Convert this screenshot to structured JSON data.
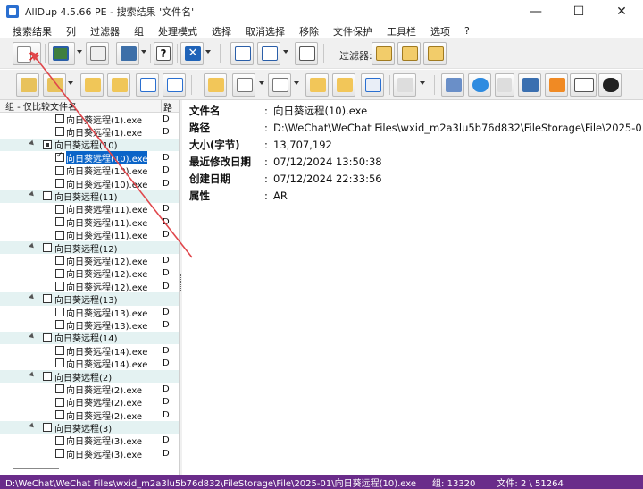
{
  "window": {
    "title": "AllDup 4.5.66 PE - 搜索结果 '文件名'",
    "controls": [
      "—",
      "☐",
      "✕"
    ]
  },
  "menu": [
    "搜索结果",
    "列",
    "过滤器",
    "组",
    "处理模式",
    "选择",
    "取消选择",
    "移除",
    "文件保护",
    "工具栏",
    "选项",
    "?"
  ],
  "toolbar": {
    "filter_label": "过滤器:",
    "icons": [
      "delete-results-icon",
      "preview-icon",
      "log-icon",
      "save-icon",
      "help-icon",
      "close-icon",
      "columns-icon",
      "columns-dropdown-icon",
      "size-units-icon",
      "filter1-icon",
      "filter2-icon",
      "filter3-icon",
      "nav-prev-icon",
      "nav-next-icon",
      "group-up-icon",
      "group-down-icon",
      "move-up-icon",
      "move-down-icon",
      "folder-icon",
      "select-icon",
      "deselect-icon",
      "folder-add-icon",
      "folder-open-icon",
      "compare-icon",
      "undo-icon",
      "image-viewer-icon",
      "ie-icon",
      "media-icon",
      "picture-icon",
      "vlc-icon",
      "exe-icon",
      "sound-icon"
    ]
  },
  "tree": {
    "header": "组 - 仅比较文件名",
    "header_col2": "路",
    "rows": [
      {
        "type": "file",
        "name": "向日葵远程(1).exe",
        "col": "D",
        "checked": false
      },
      {
        "type": "file",
        "name": "向日葵远程(1).exe",
        "col": "D",
        "checked": false
      },
      {
        "type": "group",
        "name": "向日葵远程(10)",
        "state": "partial"
      },
      {
        "type": "file",
        "name": "向日葵远程(10).exe",
        "col": "D",
        "checked": true,
        "selected": true
      },
      {
        "type": "file",
        "name": "向日葵远程(10).exe",
        "col": "D",
        "checked": false
      },
      {
        "type": "file",
        "name": "向日葵远程(10).exe",
        "col": "D",
        "checked": false
      },
      {
        "type": "group",
        "name": "向日葵远程(11)",
        "state": "none"
      },
      {
        "type": "file",
        "name": "向日葵远程(11).exe",
        "col": "D",
        "checked": false
      },
      {
        "type": "file",
        "name": "向日葵远程(11).exe",
        "col": "D",
        "checked": false
      },
      {
        "type": "file",
        "name": "向日葵远程(11).exe",
        "col": "D",
        "checked": false
      },
      {
        "type": "group",
        "name": "向日葵远程(12)",
        "state": "none"
      },
      {
        "type": "file",
        "name": "向日葵远程(12).exe",
        "col": "D",
        "checked": false
      },
      {
        "type": "file",
        "name": "向日葵远程(12).exe",
        "col": "D",
        "checked": false
      },
      {
        "type": "file",
        "name": "向日葵远程(12).exe",
        "col": "D",
        "checked": false
      },
      {
        "type": "group",
        "name": "向日葵远程(13)",
        "state": "none"
      },
      {
        "type": "file",
        "name": "向日葵远程(13).exe",
        "col": "D",
        "checked": false
      },
      {
        "type": "file",
        "name": "向日葵远程(13).exe",
        "col": "D",
        "checked": false
      },
      {
        "type": "group",
        "name": "向日葵远程(14)",
        "state": "none"
      },
      {
        "type": "file",
        "name": "向日葵远程(14).exe",
        "col": "D",
        "checked": false
      },
      {
        "type": "file",
        "name": "向日葵远程(14).exe",
        "col": "D",
        "checked": false
      },
      {
        "type": "group",
        "name": "向日葵远程(2)",
        "state": "none"
      },
      {
        "type": "file",
        "name": "向日葵远程(2).exe",
        "col": "D",
        "checked": false
      },
      {
        "type": "file",
        "name": "向日葵远程(2).exe",
        "col": "D",
        "checked": false
      },
      {
        "type": "file",
        "name": "向日葵远程(2).exe",
        "col": "D",
        "checked": false
      },
      {
        "type": "group",
        "name": "向日葵远程(3)",
        "state": "none"
      },
      {
        "type": "file",
        "name": "向日葵远程(3).exe",
        "col": "D",
        "checked": false
      },
      {
        "type": "file",
        "name": "向日葵远程(3).exe",
        "col": "D",
        "checked": false
      }
    ]
  },
  "details": [
    {
      "label": "文件名",
      "value": "向日葵远程(10).exe"
    },
    {
      "label": "路径",
      "value": "D:\\WeChat\\WeChat Files\\wxid_m2a3lu5b76d832\\FileStorage\\File\\2025-01"
    },
    {
      "label": "大小(字节)",
      "value": "13,707,192"
    },
    {
      "label": "最近修改日期",
      "value": "07/12/2024 13:50:38"
    },
    {
      "label": "创建日期",
      "value": "07/12/2024 22:33:56"
    },
    {
      "label": "属性",
      "value": "AR"
    }
  ],
  "status": {
    "path": "D:\\WeChat\\WeChat Files\\wxid_m2a3lu5b76d832\\FileStorage\\File\\2025-01\\向日葵远程(10).exe",
    "groups": "组: 13320",
    "files": "文件: 2 \\ 51264"
  },
  "colors": {
    "status_bg": "#6a2c8a",
    "selection": "#0a64c8",
    "group_row": "#e4f2f2",
    "annotation_arrow": "#e0474c"
  }
}
